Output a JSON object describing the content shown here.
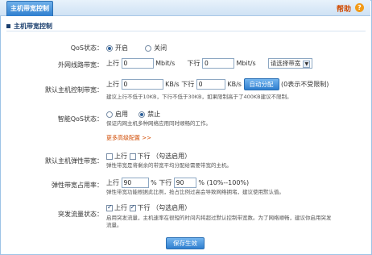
{
  "tab": {
    "title": "主机带宽控制"
  },
  "help": {
    "label": "帮助",
    "icon": "question-icon"
  },
  "section": {
    "title": "主机带宽控制"
  },
  "qos": {
    "label": "QoS状态：",
    "options": [
      "开启",
      "关闭"
    ],
    "selected": "开启"
  },
  "wan_bw": {
    "label": "外网线路带宽：",
    "up_label": "上行",
    "up_value": "0",
    "up_unit": "Mbit/s",
    "down_label": "下行",
    "down_value": "0",
    "down_unit": "Mbit/s",
    "select_value": "请选择带宽"
  },
  "host_bw": {
    "label": "默认主机控制带宽：",
    "up_label": "上行",
    "up_value": "0",
    "up_unit": "KB/s",
    "down_label": "下行",
    "down_value": "0",
    "down_unit": "KB/s",
    "auto_button": "自动分配",
    "hint": "(0表示不受限制)",
    "note": "建议上行不低于10KB，下行不低于30KB，如果限制高于了400KB建议不限制。"
  },
  "smart_qos": {
    "label": "智能QoS状态：",
    "options": [
      "启用",
      "禁止"
    ],
    "selected": "禁止",
    "note": "保证内网主机多种网络应用同时顺畅的工作。"
  },
  "more": {
    "label": "更多高级配置 >>"
  },
  "elastic_bw": {
    "label": "默认主机弹性带宽：",
    "up_label": "上行",
    "down_label": "下行",
    "hint": "（勾选启用）",
    "up_checked": false,
    "down_checked": false,
    "note": "弹性带宽是将剩余的带宽平均分配给需要带宽的主机。"
  },
  "elastic_ratio": {
    "label": "弹性带宽占用率：",
    "up_label": "上行",
    "up_value": "90",
    "pct1": "%",
    "down_label": "下行",
    "down_value": "90",
    "range": "% (10%--100%)",
    "note": "弹性带宽功能根据此比例，抢占比例过高会导致网络拥堵，建议使用默认值。"
  },
  "burst": {
    "label": "突发流量状态：",
    "up_label": "上行",
    "down_label": "下行",
    "hint": "（勾选启用）",
    "up_checked": true,
    "down_checked": true,
    "note1": "启用突发流量，主机速率在很短的时间内将超过默认控制带宽数。为了网络顺畅，建议你启用突发",
    "note2": "流量。"
  },
  "save": {
    "label": "保存生效"
  }
}
